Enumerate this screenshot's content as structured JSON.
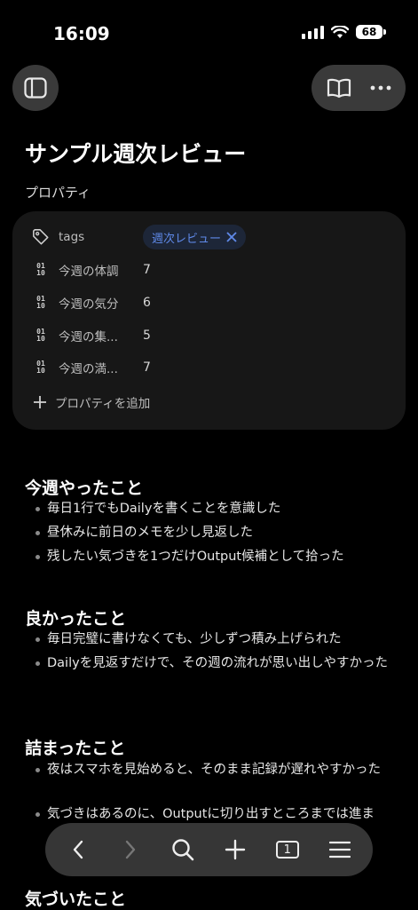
{
  "status": {
    "time": "16:09",
    "battery": "68"
  },
  "page": {
    "title": "サンプル週次レビュー",
    "properties_heading": "プロパティ"
  },
  "properties": {
    "tags": {
      "name": "tags",
      "tag": "週次レビュー"
    },
    "rows": [
      {
        "name": "今週の体調",
        "value": "7"
      },
      {
        "name": "今週の気分",
        "value": "6"
      },
      {
        "name": "今週の集...",
        "value": "5"
      },
      {
        "name": "今週の満...",
        "value": "7"
      }
    ],
    "add_label": "プロパティを追加"
  },
  "sections": [
    {
      "heading": "今週やったこと",
      "items": [
        "毎日1行でもDailyを書くことを意識した",
        "昼休みに前日のメモを少し見返した",
        "残したい気づきを1つだけOutput候補として拾った"
      ]
    },
    {
      "heading": "良かったこと",
      "items": [
        "毎日完璧に書けなくても、少しずつ積み上げられた",
        "Dailyを見返すだけで、その週の流れが思い出しやすかった"
      ]
    },
    {
      "heading": "詰まったこと",
      "items": [
        "夜はスマホを見始めると、そのまま記録が遅れやすかった",
        "気づきはあるのに、Outputに切り出すところまでは進ま"
      ]
    },
    {
      "heading": "気づいたこと",
      "items": []
    }
  ]
}
